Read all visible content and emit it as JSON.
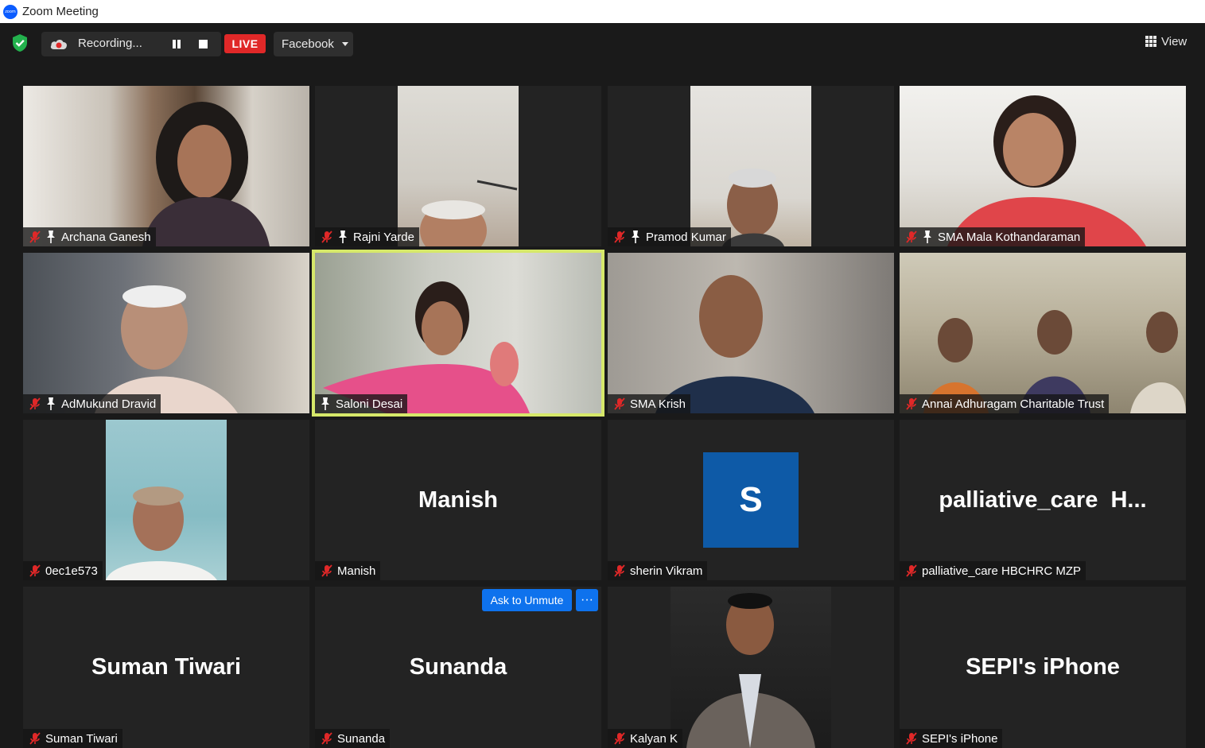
{
  "window": {
    "title": "Zoom Meeting",
    "logo_text": "zoom"
  },
  "toolbar": {
    "recording_label": "Recording...",
    "live_label": "LIVE",
    "stream_target": "Facebook",
    "view_label": "View"
  },
  "colors": {
    "live": "#e02828",
    "speaker_border": "#d6e86a",
    "button_blue": "#0e72ed",
    "avatar_blue": "#0e5aa7",
    "mic_muted": "#e02828"
  },
  "participants": [
    {
      "name": "Archana Ganesh",
      "muted": true,
      "pinned": true,
      "video": true
    },
    {
      "name": "Rajni Yarde",
      "muted": true,
      "pinned": true,
      "video": true
    },
    {
      "name": "Pramod Kumar",
      "muted": true,
      "pinned": true,
      "video": true
    },
    {
      "name": "SMA Mala Kothandaraman",
      "muted": true,
      "pinned": true,
      "video": true
    },
    {
      "name": "AdMukund Dravid",
      "muted": true,
      "pinned": true,
      "video": true
    },
    {
      "name": "Saloni Desai",
      "muted": false,
      "pinned": true,
      "video": true,
      "active_speaker": true
    },
    {
      "name": "SMA Krish",
      "muted": true,
      "pinned": false,
      "video": true
    },
    {
      "name": "Annai Adhuragam Charitable Trust",
      "muted": true,
      "pinned": false,
      "video": true
    },
    {
      "name": "0ec1e573",
      "muted": true,
      "pinned": false,
      "video": true
    },
    {
      "name": "Manish",
      "muted": true,
      "pinned": false,
      "video": false,
      "display": "Manish"
    },
    {
      "name": "sherin Vikram",
      "muted": true,
      "pinned": false,
      "video": false,
      "avatar_letter": "S"
    },
    {
      "name": "palliative_care HBCHRC MZP",
      "muted": true,
      "pinned": false,
      "video": false,
      "display": "palliative_care  H..."
    },
    {
      "name": "Suman Tiwari",
      "muted": true,
      "pinned": false,
      "video": false,
      "display": "Suman Tiwari"
    },
    {
      "name": "Sunanda",
      "muted": true,
      "pinned": false,
      "video": false,
      "display": "Sunanda"
    },
    {
      "name": "Kalyan K",
      "muted": true,
      "pinned": false,
      "video": true
    },
    {
      "name": "SEPI's iPhone",
      "muted": true,
      "pinned": false,
      "video": false,
      "display": "SEPI's iPhone"
    }
  ],
  "hover_actions": {
    "ask_to_unmute": "Ask to Unmute",
    "more": "···"
  }
}
